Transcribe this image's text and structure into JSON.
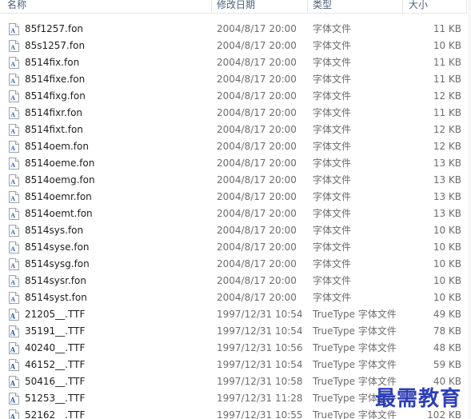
{
  "columns": {
    "name": "名称",
    "date": "修改日期",
    "type": "类型",
    "size": "大小"
  },
  "files": [
    {
      "name": "85f1257.fon",
      "date": "2004/8/17 20:00",
      "type": "字体文件",
      "size": "11 KB",
      "icon": "font-file-icon"
    },
    {
      "name": "85s1257.fon",
      "date": "2004/8/17 20:00",
      "type": "字体文件",
      "size": "10 KB",
      "icon": "font-file-icon"
    },
    {
      "name": "8514fix.fon",
      "date": "2004/8/17 20:00",
      "type": "字体文件",
      "size": "11 KB",
      "icon": "font-file-icon"
    },
    {
      "name": "8514fixe.fon",
      "date": "2004/8/17 20:00",
      "type": "字体文件",
      "size": "11 KB",
      "icon": "font-file-icon"
    },
    {
      "name": "8514fixg.fon",
      "date": "2004/8/17 20:00",
      "type": "字体文件",
      "size": "12 KB",
      "icon": "font-file-icon"
    },
    {
      "name": "8514fixr.fon",
      "date": "2004/8/17 20:00",
      "type": "字体文件",
      "size": "11 KB",
      "icon": "font-file-icon"
    },
    {
      "name": "8514fixt.fon",
      "date": "2004/8/17 20:00",
      "type": "字体文件",
      "size": "12 KB",
      "icon": "font-file-icon"
    },
    {
      "name": "8514oem.fon",
      "date": "2004/8/17 20:00",
      "type": "字体文件",
      "size": "12 KB",
      "icon": "font-file-icon"
    },
    {
      "name": "8514oeme.fon",
      "date": "2004/8/17 20:00",
      "type": "字体文件",
      "size": "13 KB",
      "icon": "font-file-icon"
    },
    {
      "name": "8514oemg.fon",
      "date": "2004/8/17 20:00",
      "type": "字体文件",
      "size": "13 KB",
      "icon": "font-file-icon"
    },
    {
      "name": "8514oemr.fon",
      "date": "2004/8/17 20:00",
      "type": "字体文件",
      "size": "13 KB",
      "icon": "font-file-icon"
    },
    {
      "name": "8514oemt.fon",
      "date": "2004/8/17 20:00",
      "type": "字体文件",
      "size": "13 KB",
      "icon": "font-file-icon"
    },
    {
      "name": "8514sys.fon",
      "date": "2004/8/17 20:00",
      "type": "字体文件",
      "size": "10 KB",
      "icon": "font-file-icon"
    },
    {
      "name": "8514syse.fon",
      "date": "2004/8/17 20:00",
      "type": "字体文件",
      "size": "10 KB",
      "icon": "font-file-icon"
    },
    {
      "name": "8514sysg.fon",
      "date": "2004/8/17 20:00",
      "type": "字体文件",
      "size": "10 KB",
      "icon": "font-file-icon"
    },
    {
      "name": "8514sysr.fon",
      "date": "2004/8/17 20:00",
      "type": "字体文件",
      "size": "10 KB",
      "icon": "font-file-icon"
    },
    {
      "name": "8514syst.fon",
      "date": "2004/8/17 20:00",
      "type": "字体文件",
      "size": "10 KB",
      "icon": "font-file-icon"
    },
    {
      "name": "21205__.TTF",
      "date": "1997/12/31 10:54",
      "type": "TrueType 字体文件",
      "size": "49 KB",
      "icon": "truetype-file-icon"
    },
    {
      "name": "35191__.TTF",
      "date": "1997/12/31 10:54",
      "type": "TrueType 字体文件",
      "size": "78 KB",
      "icon": "truetype-file-icon"
    },
    {
      "name": "40240__.TTF",
      "date": "1997/12/31 10:56",
      "type": "TrueType 字体文件",
      "size": "48 KB",
      "icon": "truetype-file-icon"
    },
    {
      "name": "46152__.TTF",
      "date": "1997/12/31 10:54",
      "type": "TrueType 字体文件",
      "size": "59 KB",
      "icon": "truetype-file-icon"
    },
    {
      "name": "50416__.TTF",
      "date": "1997/12/31 10:58",
      "type": "TrueType 字体文件",
      "size": "40 KB",
      "icon": "truetype-file-icon"
    },
    {
      "name": "51253__.TTF",
      "date": "1997/12/31 11:28",
      "type": "TrueType 字体文件",
      "size": "",
      "icon": "truetype-file-icon"
    },
    {
      "name": "52162__.TTF",
      "date": "1997/12/31 10:55",
      "type": "TrueType 字体文件",
      "size": "102 KB",
      "icon": "truetype-file-icon"
    }
  ],
  "watermark": "最需教育",
  "colors": {
    "header_text": "#4c607a",
    "name_text": "#1e1e1e",
    "meta_text": "#6d6d6d",
    "watermark": "#1c2fb0"
  }
}
